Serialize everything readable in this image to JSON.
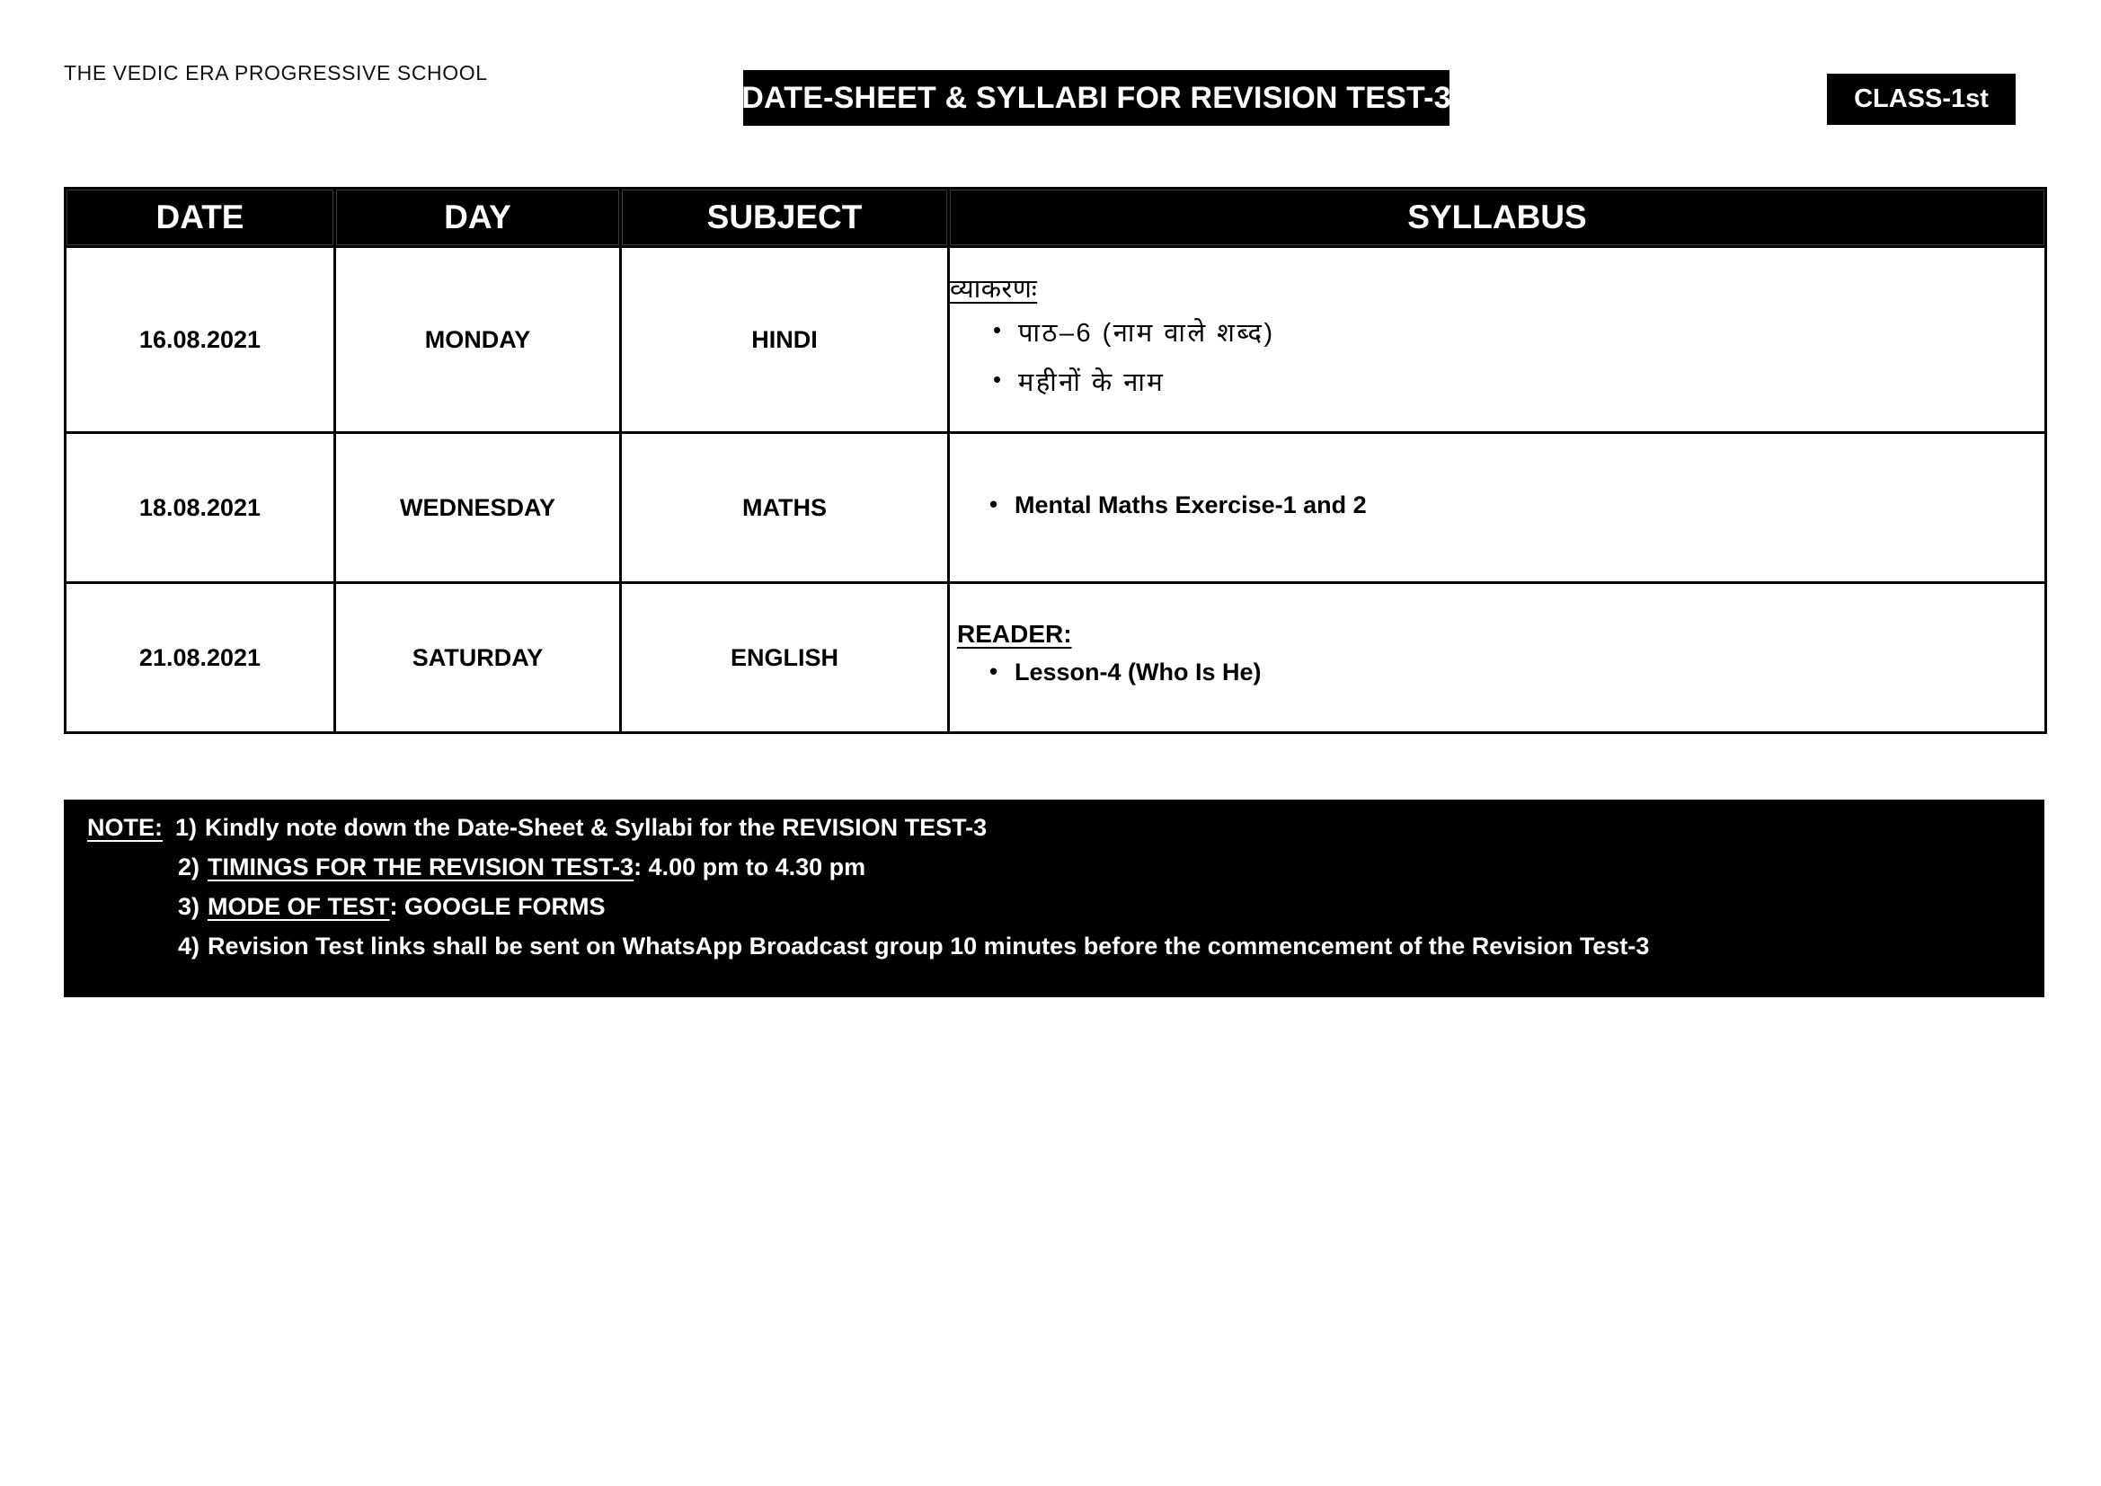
{
  "header": {
    "school_name": "THE VEDIC ERA PROGRESSIVE SCHOOL",
    "title": "DATE-SHEET & SYLLABI FOR REVISION TEST-3",
    "class_badge": "CLASS-1st"
  },
  "table": {
    "columns": [
      "DATE",
      "DAY",
      "SUBJECT",
      "SYLLABUS"
    ],
    "rows": [
      {
        "date": "16.08.2021",
        "day": "MONDAY",
        "subject": "HINDI",
        "syllabus_heading": "व्याकरणः",
        "syllabus_items": [
          "पाठ–6 (नाम वाले शब्द)",
          "महीनों के नाम"
        ]
      },
      {
        "date": "18.08.2021",
        "day": "WEDNESDAY",
        "subject": "MATHS",
        "syllabus_heading": "",
        "syllabus_items": [
          "Mental Maths Exercise-1 and 2"
        ]
      },
      {
        "date": "21.08.2021",
        "day": "SATURDAY",
        "subject": "ENGLISH",
        "syllabus_heading": "READER:",
        "syllabus_items": [
          "Lesson-4 (Who Is He)"
        ]
      }
    ]
  },
  "note": {
    "label": "NOTE:",
    "items": [
      {
        "number": "1)",
        "underlined": "",
        "text": "Kindly note down the Date-Sheet & Syllabi for the REVISION TEST-3"
      },
      {
        "number": "2)",
        "underlined": "TIMINGS FOR THE REVISION TEST-3",
        "text": " : 4.00 pm to 4.30 pm"
      },
      {
        "number": "3)",
        "underlined": "MODE OF TEST",
        "text": " : GOOGLE FORMS"
      },
      {
        "number": "4)",
        "underlined": "",
        "text": "Revision Test links shall be sent on WhatsApp Broadcast group 10 minutes before the commencement of the Revision Test-3"
      }
    ]
  },
  "colors": {
    "ink": "#000000",
    "paper": "#ffffff",
    "banner_text": "#ffffff"
  }
}
